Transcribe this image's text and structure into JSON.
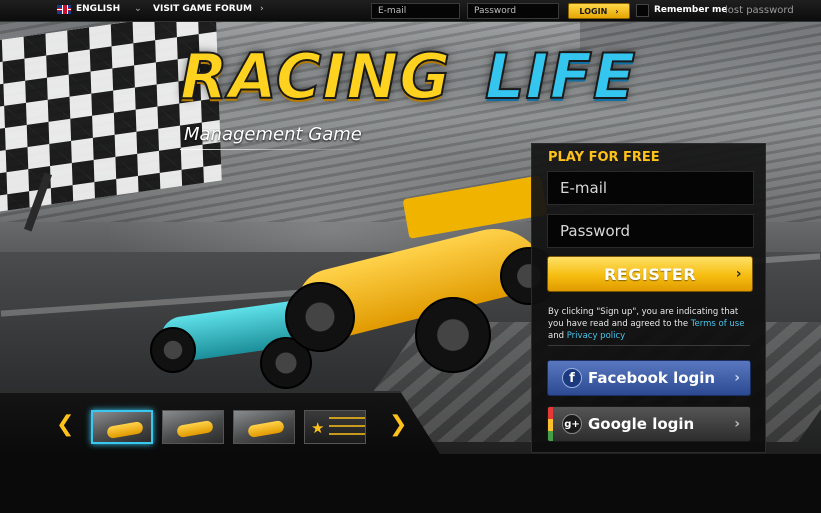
{
  "topbar": {
    "language": "ENGLISH",
    "forum_link": "VISIT GAME FORUM",
    "email_placeholder": "E-mail",
    "password_placeholder": "Password",
    "login_label": "LOGIN",
    "remember_label": "Remember me",
    "lost_password": "lost password"
  },
  "hero": {
    "logo_part1": "RACING",
    "logo_part2": "LIFE",
    "subtitle": "Management Game"
  },
  "signup": {
    "title": "PLAY FOR FREE",
    "email_placeholder": "E-mail",
    "password_placeholder": "Password",
    "register_label": "REGISTER",
    "terms_prefix": "By clicking \"Sign up\", you are indicating that you have read and agreed to the ",
    "terms_link": "Terms of use",
    "terms_and": " and ",
    "privacy_link": "Privacy policy",
    "facebook_label": "Facebook login",
    "google_label": "Google login"
  },
  "gallery": {
    "active_index": 0
  },
  "colors": {
    "accent_yellow": "#ffc21a",
    "accent_cyan": "#38c8f0",
    "facebook_blue": "#3b5998"
  }
}
